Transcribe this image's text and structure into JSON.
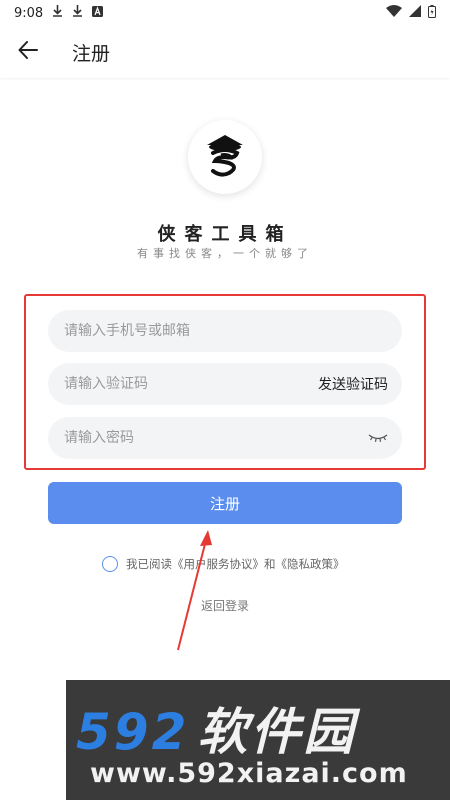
{
  "status_bar": {
    "time": "9:08",
    "left_icons": [
      "download-icon",
      "download-icon",
      "app-a-icon"
    ],
    "right_icons": [
      "wifi-icon",
      "signal-icon",
      "battery-icon"
    ]
  },
  "header": {
    "title": "注册"
  },
  "brand": {
    "name": "侠客工具箱",
    "slogan": "有事找侠客，一个就够了"
  },
  "form": {
    "phone": {
      "placeholder": "请输入手机号或邮箱",
      "value": ""
    },
    "code": {
      "placeholder": "请输入验证码",
      "value": "",
      "send_label": "发送验证码"
    },
    "password": {
      "placeholder": "请输入密码",
      "value": ""
    },
    "submit_label": "注册"
  },
  "agreement": {
    "checked": false,
    "text": "我已阅读《用户服务协议》和《隐私政策》"
  },
  "back_to_login": "返回登录",
  "watermark": {
    "number": "592",
    "cn": "软件园",
    "url": "www.592xiazai.com"
  },
  "colors": {
    "accent": "#5b8dee",
    "highlight": "#e53935",
    "field_bg": "#f3f4f6",
    "watermark_blue": "#2c7fe0"
  }
}
